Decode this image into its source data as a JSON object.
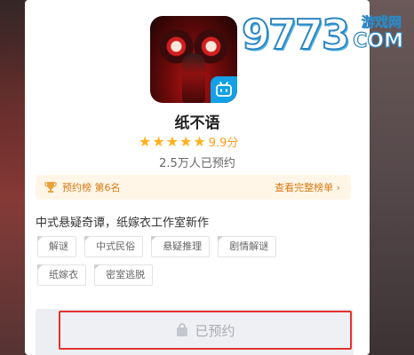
{
  "game": {
    "title": "纸不语",
    "stars": 5,
    "score": "9.9分",
    "reserve_count": "2.5万人已预约",
    "description": "中式悬疑奇谭，纸嫁衣工作室新作",
    "tags": [
      "解谜",
      "中式民俗",
      "悬疑推理",
      "剧情解谜",
      "纸嫁衣",
      "密室逃脱"
    ]
  },
  "rank": {
    "text": "预约榜 第6名",
    "link": "查看完整榜单 ›"
  },
  "reserve_button": {
    "label": "已预约"
  },
  "watermark": {
    "digits": "9773",
    "cn": "游戏网",
    "com": "COM"
  },
  "colors": {
    "star": "#ffb11b",
    "rank_text": "#d77a12",
    "rank_bg": "#fff6e8",
    "highlight_border": "#e23232",
    "bilibili": "#13a0e6"
  },
  "icons": {
    "star": "star-icon",
    "trophy": "trophy-icon",
    "bilibili": "bilibili-tv-icon",
    "bag": "gift-bag-icon"
  }
}
